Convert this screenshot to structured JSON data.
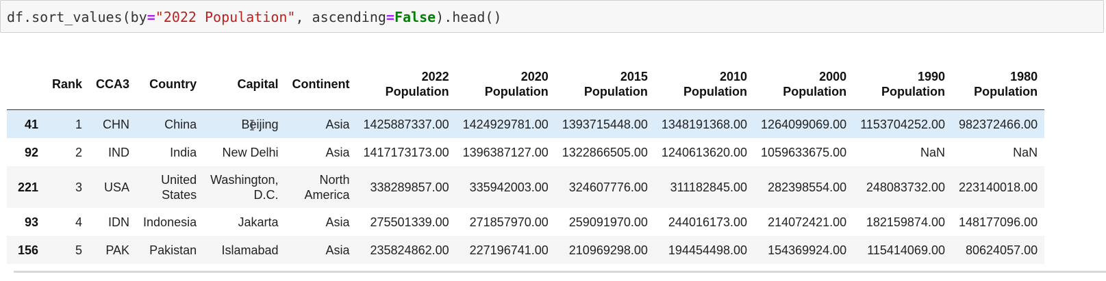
{
  "code_cell": {
    "prefix": "df.sort_values(by",
    "eq1": "=",
    "string_arg": "\"2022 Population\"",
    "middle": ", ascending",
    "eq2": "=",
    "keyword": "False",
    "suffix": ").head()"
  },
  "table": {
    "columns": [
      {
        "line1": "Rank",
        "line2": ""
      },
      {
        "line1": "CCA3",
        "line2": ""
      },
      {
        "line1": "Country",
        "line2": ""
      },
      {
        "line1": "Capital",
        "line2": ""
      },
      {
        "line1": "Continent",
        "line2": ""
      },
      {
        "line1": "2022",
        "line2": "Population"
      },
      {
        "line1": "2020",
        "line2": "Population"
      },
      {
        "line1": "2015",
        "line2": "Population"
      },
      {
        "line1": "2010",
        "line2": "Population"
      },
      {
        "line1": "2000",
        "line2": "Population"
      },
      {
        "line1": "1990",
        "line2": "Population"
      },
      {
        "line1": "1980",
        "line2": "Population"
      }
    ],
    "rows": [
      {
        "index": "41",
        "rank": "1",
        "cca3": "CHN",
        "country": [
          "China"
        ],
        "capital": [
          "Beijing"
        ],
        "continent": [
          "Asia"
        ],
        "pop2022": "1425887337.00",
        "pop2020": "1424929781.00",
        "pop2015": "1393715448.00",
        "pop2010": "1348191368.00",
        "pop2000": "1264099069.00",
        "pop1990": "1153704252.00",
        "pop1980": "982372466.00"
      },
      {
        "index": "92",
        "rank": "2",
        "cca3": "IND",
        "country": [
          "India"
        ],
        "capital": [
          "New Delhi"
        ],
        "continent": [
          "Asia"
        ],
        "pop2022": "1417173173.00",
        "pop2020": "1396387127.00",
        "pop2015": "1322866505.00",
        "pop2010": "1240613620.00",
        "pop2000": "1059633675.00",
        "pop1990": "NaN",
        "pop1980": "NaN"
      },
      {
        "index": "221",
        "rank": "3",
        "cca3": "USA",
        "country": [
          "United",
          "States"
        ],
        "capital": [
          "Washington,",
          "D.C."
        ],
        "continent": [
          "North",
          "America"
        ],
        "pop2022": "338289857.00",
        "pop2020": "335942003.00",
        "pop2015": "324607776.00",
        "pop2010": "311182845.00",
        "pop2000": "282398554.00",
        "pop1990": "248083732.00",
        "pop1980": "223140018.00"
      },
      {
        "index": "93",
        "rank": "4",
        "cca3": "IDN",
        "country": [
          "Indonesia"
        ],
        "capital": [
          "Jakarta"
        ],
        "continent": [
          "Asia"
        ],
        "pop2022": "275501339.00",
        "pop2020": "271857970.00",
        "pop2015": "259091970.00",
        "pop2010": "244016173.00",
        "pop2000": "214072421.00",
        "pop1990": "182159874.00",
        "pop1980": "148177096.00"
      },
      {
        "index": "156",
        "rank": "5",
        "cca3": "PAK",
        "country": [
          "Pakistan"
        ],
        "capital": [
          "Islamabad"
        ],
        "continent": [
          "Asia"
        ],
        "pop2022": "235824862.00",
        "pop2020": "227196741.00",
        "pop2015": "210969298.00",
        "pop2010": "194454498.00",
        "pop2000": "154369924.00",
        "pop1990": "115414069.00",
        "pop1980": "80624057.00"
      }
    ]
  },
  "icons": {
    "cursor": "i-beam-cursor-icon"
  },
  "colors": {
    "string": "#ba2121",
    "operator": "#aa22ff",
    "keyword": "#008000",
    "highlight_row": "#dcecf9"
  }
}
